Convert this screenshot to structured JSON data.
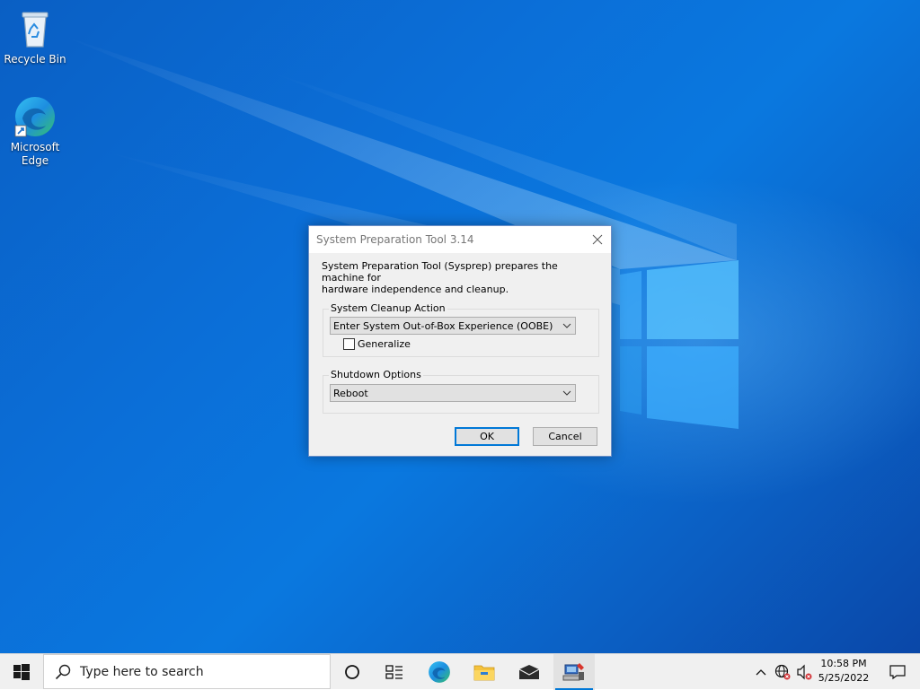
{
  "desktop": {
    "icons": [
      {
        "label": "Recycle Bin",
        "icon": "recycle-bin-icon"
      },
      {
        "label": "Microsoft Edge",
        "label_lines": [
          "Microsoft",
          "Edge"
        ],
        "icon": "edge-icon"
      }
    ]
  },
  "dialog": {
    "title": "System Preparation Tool 3.14",
    "description_lines": [
      "System Preparation Tool (Sysprep) prepares the machine for",
      "hardware independence and cleanup."
    ],
    "cleanup_group": {
      "title": "System Cleanup Action",
      "selected": "Enter System Out-of-Box Experience (OOBE)",
      "generalize_label": "Generalize",
      "generalize_checked": false
    },
    "shutdown_group": {
      "title": "Shutdown Options",
      "selected": "Reboot"
    },
    "ok_label": "OK",
    "cancel_label": "Cancel"
  },
  "taskbar": {
    "search_placeholder": "Type here to search",
    "pinned": [
      "start-icon",
      "cortana-icon",
      "task-view-icon",
      "edge-icon",
      "file-explorer-icon",
      "mail-icon",
      "sysprep-app-icon"
    ],
    "tray": [
      "chevron-up-icon",
      "network-icon",
      "volume-muted-icon",
      "notifications-icon"
    ],
    "clock_time": "10:58 PM",
    "clock_date": "5/25/2022"
  },
  "colors": {
    "accent": "#0078d7",
    "desktop_blue": "#0b6fd8",
    "taskbar": "#f0f0f0",
    "dialog_bg": "#f0f0f0"
  }
}
